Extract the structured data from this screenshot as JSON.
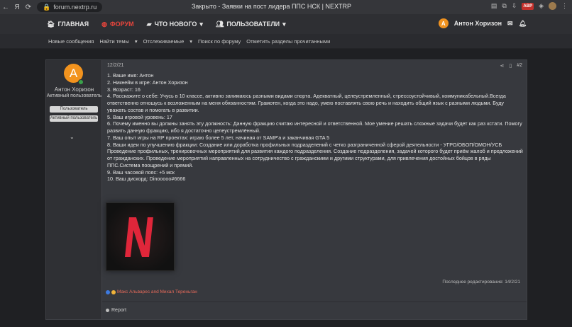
{
  "browser": {
    "url": "forum.nextrp.ru",
    "window_title": "Закрыто - Заявки на пост лидера ППС НСК | NEXTRP",
    "nav": {
      "back": "←",
      "fwd": "Я",
      "reload": "⟳",
      "home": "⌂"
    },
    "ext": {
      "abp": "ABP"
    }
  },
  "nav": {
    "home": "ГЛАВНАЯ",
    "forums": "ФОРУМ",
    "whats_new": "ЧТО НОВОГО",
    "members": "ПОЛЬЗОВАТЕЛИ",
    "user_initial": "А",
    "user_name": "Антон Хоризон"
  },
  "subnav": [
    "Новые сообщения",
    "Найти темы",
    "Отслеживаемые",
    "Поиск по форуму",
    "Отметить разделы прочитанными"
  ],
  "post": {
    "author": {
      "initial": "А",
      "name": "Антон Хоризон",
      "title": "Активный пользователь",
      "badges": [
        "Пользователь",
        "Активный пользователь"
      ]
    },
    "date": "12/2/21",
    "number": "#2",
    "lines": [
      "1. Ваше имя: Антон",
      "2. Никнейм в игре: Антон Хоризон",
      "3. Возраст: 16",
      "4. Расскажите о себе: Учусь в 10 классе, активно занимаюсь разными видами спорта. Адекватный, целеустремленный, стрессоустойчивый, коммуникабельный.Всегда ответственно отношусь к возложенным на меня обязанностям. Грамотен, когда это надо, умею поставлять свою речь и находить общий язык с разными людьми. Буду уважать состав и помогать в развитии.",
      "5. Ваш игровой уровень: 17",
      "6. Почему именно вы должны занять эту должность: Данную фракцию считаю интересной и ответственной. Мое умение решать сложные задачи будет как раз кстати. Помогу развить данную фракцию, ибо я достаточно целеустремлённый.",
      "7. Ваш опыт игры на RP проектах: играю более 5 лет, начиная от SAMP'a и заканчивая GTA 5",
      "8. Ваши идеи по улучшению фракции: Создание или доработка профильных подразделений с четко разграниченной сферой деятельности - УГРО/ОБОП/ОМОН/УСБ Проведение профильных, тренировочных мероприятий для развития каждого подразделения. Создание подразделения, задачей которого будет приём жалоб и предложений от гражданских. Проведение мероприятий направленных на сотрудничество с гражданскими и другими структурами, для привлечения достойных бойцов в ряды ППС.Система поощрений и премий.",
      "9. Ваш часовой пояс: +5 мск",
      "10. Ваш дискорд: Dinooooo#6666"
    ],
    "attachment_letter": "N",
    "edited": "Последнее редактирование: 14/2/21",
    "reactions": "Макс Альварес and Михал Тереньган",
    "report": "Report"
  }
}
